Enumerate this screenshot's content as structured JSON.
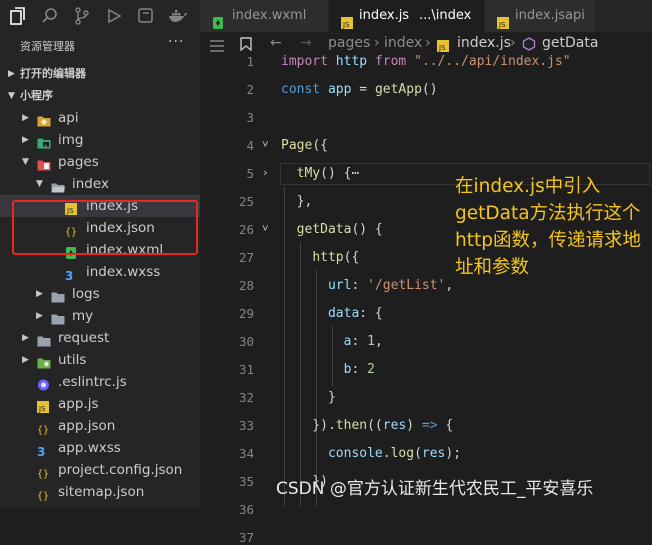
{
  "sidebar": {
    "title": "资源管理器",
    "more": "···",
    "sections": [
      {
        "label": "打开的编辑器",
        "expanded": false
      },
      {
        "label": "小程序",
        "expanded": true
      }
    ],
    "tree": [
      {
        "name": "api",
        "kind": "folder-special",
        "color": "#d9a43d",
        "depth": 1,
        "expanded": false
      },
      {
        "name": "img",
        "kind": "folder-img",
        "color": "#3aa67a",
        "depth": 1,
        "expanded": false
      },
      {
        "name": "pages",
        "kind": "folder-pages",
        "color": "#e05252",
        "depth": 1,
        "expanded": true
      },
      {
        "name": "index",
        "kind": "folder-open",
        "color": "#9aa3ad",
        "depth": 2,
        "expanded": true
      },
      {
        "name": "index.js",
        "kind": "js",
        "color": "#e8c22e",
        "depth": 3
      },
      {
        "name": "index.json",
        "kind": "json",
        "color": "#e8c22e",
        "depth": 3
      },
      {
        "name": "index.wxml",
        "kind": "wxml",
        "color": "#3fb950",
        "depth": 3
      },
      {
        "name": "index.wxss",
        "kind": "wxss",
        "color": "#4fa3ff",
        "depth": 3
      },
      {
        "name": "logs",
        "kind": "folder",
        "color": "#9aa3ad",
        "depth": 2,
        "expanded": false
      },
      {
        "name": "my",
        "kind": "folder",
        "color": "#9aa3ad",
        "depth": 2,
        "expanded": false
      },
      {
        "name": "request",
        "kind": "folder",
        "color": "#9aa3ad",
        "depth": 1,
        "expanded": false
      },
      {
        "name": "utils",
        "kind": "folder-utils",
        "color": "#6ab04c",
        "depth": 1,
        "expanded": false
      },
      {
        "name": ".eslintrc.js",
        "kind": "eslint",
        "color": "#6c63ff",
        "depth": 1
      },
      {
        "name": "app.js",
        "kind": "js",
        "color": "#e8c22e",
        "depth": 1
      },
      {
        "name": "app.json",
        "kind": "json",
        "color": "#e8c22e",
        "depth": 1
      },
      {
        "name": "app.wxss",
        "kind": "wxss",
        "color": "#4fa3ff",
        "depth": 1
      },
      {
        "name": "project.config.json",
        "kind": "json",
        "color": "#e8c22e",
        "depth": 1
      },
      {
        "name": "sitemap.json",
        "kind": "json",
        "color": "#e8c22e",
        "depth": 1
      }
    ]
  },
  "tabs": [
    {
      "label": "index.wxml",
      "icon": "wxml",
      "active": false
    },
    {
      "label": "index.js",
      "suffix": "...\\index",
      "icon": "js",
      "active": true
    },
    {
      "label": "index.js",
      "suffix": "api",
      "icon": "js",
      "active": false
    }
  ],
  "breadcrumb": [
    "pages",
    "index",
    "index.js",
    "getData"
  ],
  "editor": {
    "line_numbers": [
      "1",
      "2",
      "3",
      "4",
      "5",
      "25",
      "26",
      "27",
      "28",
      "29",
      "30",
      "31",
      "32",
      "33",
      "34",
      "35",
      "36",
      "37"
    ],
    "lines": [
      [
        [
          "kw",
          "import"
        ],
        [
          "pl",
          " "
        ],
        [
          "id",
          "http"
        ],
        [
          "pl",
          " "
        ],
        [
          "kw",
          "from"
        ],
        [
          "pl",
          " "
        ],
        [
          "str",
          "\"../../api/index.js\""
        ]
      ],
      [
        [
          "st",
          "const"
        ],
        [
          "pl",
          " "
        ],
        [
          "id",
          "app"
        ],
        [
          "pl",
          " = "
        ],
        [
          "fn",
          "getApp"
        ],
        [
          "pl",
          "()"
        ]
      ],
      [],
      [
        [
          "fn",
          "Page"
        ],
        [
          "pl",
          "({"
        ]
      ],
      [
        [
          "pl",
          "  "
        ],
        [
          "fn",
          "tMy"
        ],
        [
          "pl",
          "() {"
        ],
        [
          "pl",
          "⋯"
        ]
      ],
      [
        [
          "pl",
          "  },"
        ]
      ],
      [
        [
          "pl",
          "  "
        ],
        [
          "fn",
          "getData"
        ],
        [
          "pl",
          "() {"
        ]
      ],
      [
        [
          "pl",
          "    "
        ],
        [
          "fn",
          "http"
        ],
        [
          "pl",
          "({"
        ]
      ],
      [
        [
          "pl",
          "      "
        ],
        [
          "id",
          "url"
        ],
        [
          "pl",
          ": "
        ],
        [
          "str",
          "'/getList'"
        ],
        [
          "pl",
          ","
        ]
      ],
      [
        [
          "pl",
          "      "
        ],
        [
          "id",
          "data"
        ],
        [
          "pl",
          ": {"
        ]
      ],
      [
        [
          "pl",
          "        "
        ],
        [
          "id",
          "a"
        ],
        [
          "pl",
          ": "
        ],
        [
          "num",
          "1"
        ],
        [
          "pl",
          ","
        ]
      ],
      [
        [
          "pl",
          "        "
        ],
        [
          "id",
          "b"
        ],
        [
          "pl",
          ": "
        ],
        [
          "num",
          "2"
        ]
      ],
      [
        [
          "pl",
          "      }"
        ]
      ],
      [
        [
          "pl",
          "    })."
        ],
        [
          "fn",
          "then"
        ],
        [
          "pl",
          "(("
        ],
        [
          "id",
          "res"
        ],
        [
          "pl",
          ") "
        ],
        [
          "st",
          "=>"
        ],
        [
          "pl",
          " {"
        ]
      ],
      [
        [
          "pl",
          "      "
        ],
        [
          "id",
          "console"
        ],
        [
          "pl",
          "."
        ],
        [
          "fn",
          "log"
        ],
        [
          "pl",
          "("
        ],
        [
          "id",
          "res"
        ],
        [
          "pl",
          ");"
        ]
      ],
      [
        [
          "pl",
          "    })"
        ]
      ],
      [],
      []
    ]
  },
  "annotation": "在index.js中引入getData方法执行这个http函数，传递请求地址和参数",
  "watermark": "CSDN @官方认证新生代农民工_平安喜乐"
}
